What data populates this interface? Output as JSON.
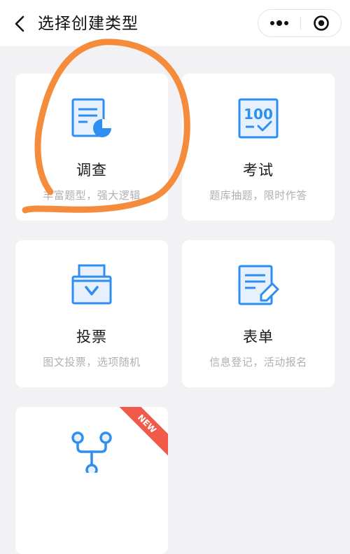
{
  "header": {
    "back_icon": "chevron-left-icon",
    "title": "选择创建类型",
    "menu_icon": "more-dots-icon",
    "close_icon": "target-circle-icon"
  },
  "cards": [
    {
      "title": "调查",
      "desc": "丰富题型，强大逻辑",
      "icon": "survey-chart-icon"
    },
    {
      "title": "考试",
      "desc": "题库抽题，限时作答",
      "icon": "exam-score-icon"
    },
    {
      "title": "投票",
      "desc": "图文投票，选项随机",
      "icon": "ballot-box-icon"
    },
    {
      "title": "表单",
      "desc": "信息登记，活动报名",
      "icon": "form-edit-icon"
    },
    {
      "title": "",
      "desc": "",
      "icon": "flow-branch-icon",
      "badge": "NEW"
    }
  ],
  "exam_icon_text": "100",
  "colors": {
    "accent": "#2f8ff0",
    "annotation": "#f58c3c",
    "badge": "#f15a4a"
  }
}
